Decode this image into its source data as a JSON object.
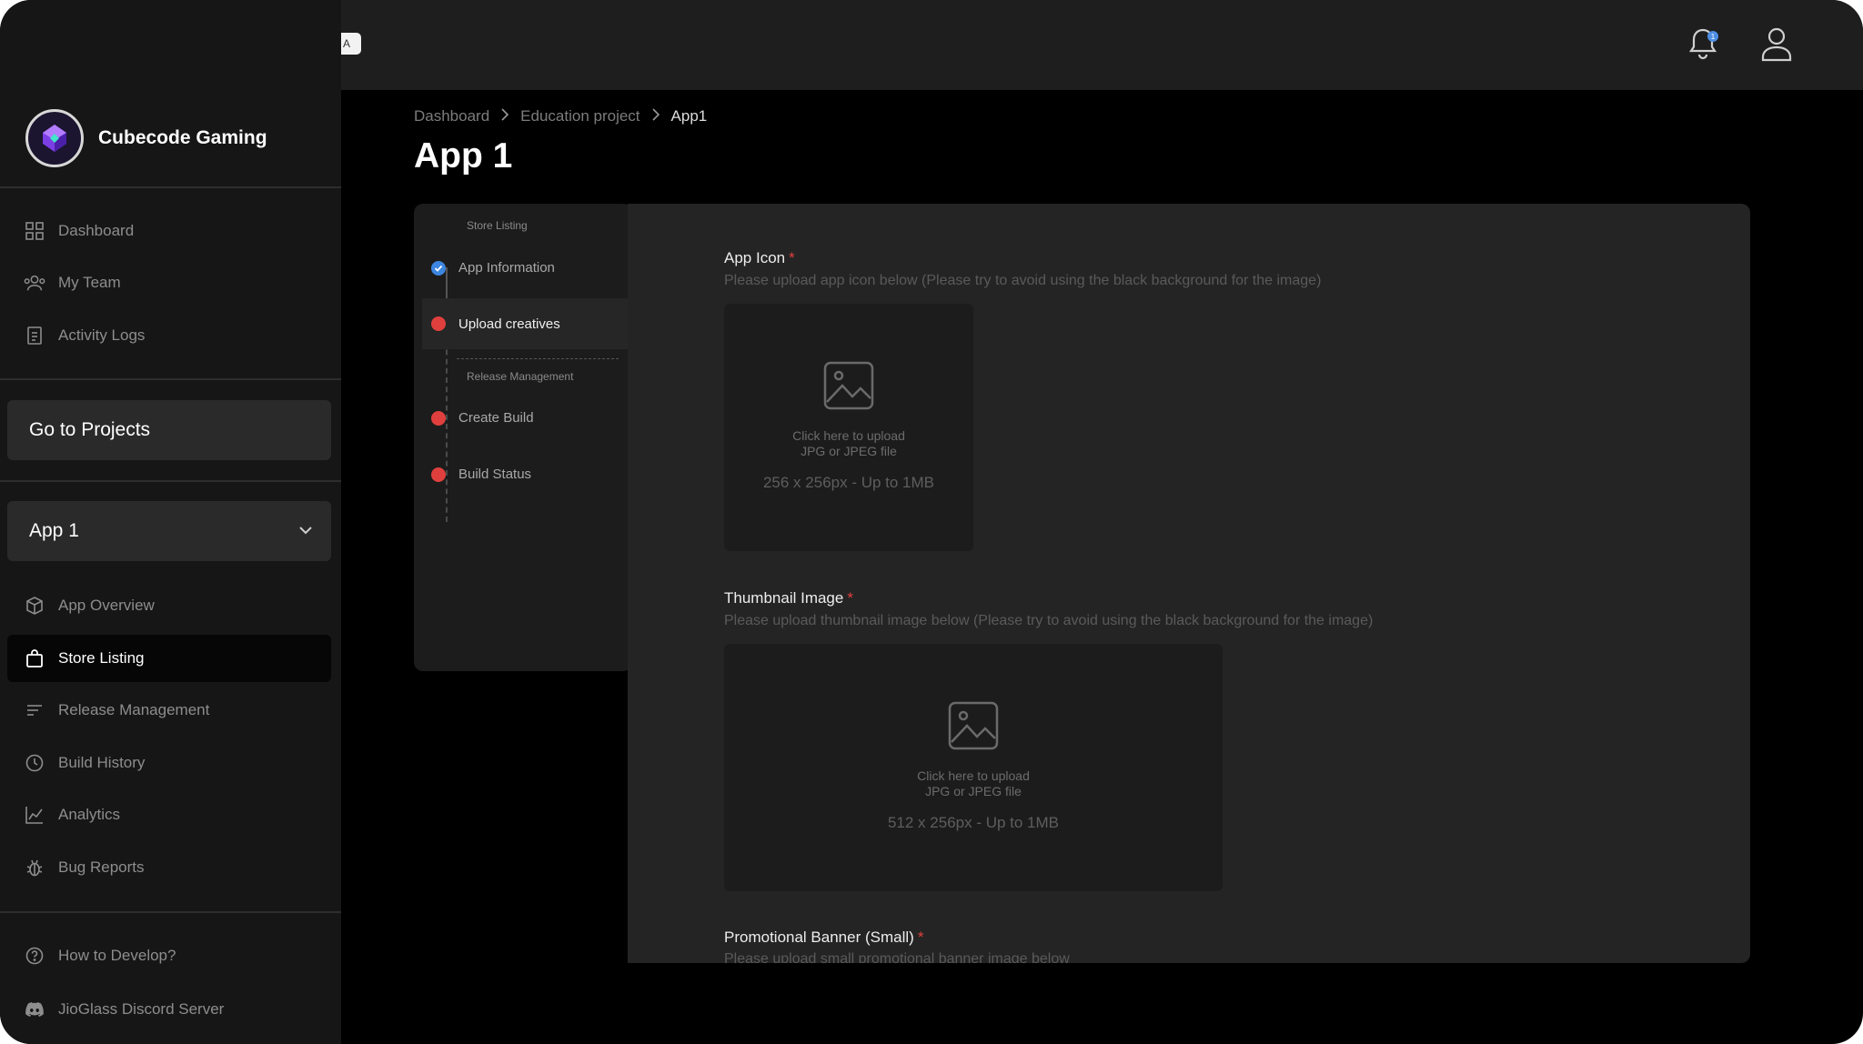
{
  "brand": {
    "name": "Cubecode Gaming"
  },
  "sidebar": {
    "top_items": [
      {
        "label": "Dashboard",
        "icon": "grid-icon"
      },
      {
        "label": "My Team",
        "icon": "team-icon"
      },
      {
        "label": "Activity Logs",
        "icon": "document-icon"
      }
    ],
    "go_to_projects": "Go to Projects",
    "app_selector": "App 1",
    "app_items": [
      {
        "label": "App Overview",
        "icon": "cube-icon"
      },
      {
        "label": "Store Listing",
        "icon": "bag-icon",
        "active": true
      },
      {
        "label": "Release Management",
        "icon": "list-icon"
      },
      {
        "label": "Build History",
        "icon": "history-icon"
      },
      {
        "label": "Analytics",
        "icon": "chart-icon"
      },
      {
        "label": "Bug Reports",
        "icon": "bug-icon"
      }
    ],
    "bottom_items": [
      {
        "label": "How to Develop?",
        "icon": "help-icon"
      },
      {
        "label": "JioGlass Discord Server",
        "icon": "discord-icon"
      }
    ]
  },
  "topbar": {
    "badge_letter": "A",
    "notification_count": "1"
  },
  "breadcrumb": [
    "Dashboard",
    "Education project",
    "App1"
  ],
  "page_title": "App 1",
  "steps": {
    "section1": "Store Listing",
    "section2": "Release Management",
    "items": [
      {
        "label": "App Information",
        "status": "done"
      },
      {
        "label": "Upload creatives",
        "status": "current"
      },
      {
        "label": "Create Build",
        "status": "pending"
      },
      {
        "label": "Build Status",
        "status": "pending"
      }
    ]
  },
  "fields": {
    "app_icon": {
      "title": "App Icon",
      "required": "*",
      "desc": "Please upload app icon below (Please try to avoid using the black background for the image)",
      "upload_line1": "Click here to upload",
      "upload_line2": "JPG or JPEG file",
      "size": "256 x 256px - Up to 1MB"
    },
    "thumbnail": {
      "title": "Thumbnail Image",
      "required": "*",
      "desc": "Please upload thumbnail image below (Please try to avoid using the black background for the image)",
      "upload_line1": "Click here to upload",
      "upload_line2": "JPG or JPEG file",
      "size": "512 x 256px - Up to 1MB"
    },
    "promo_small": {
      "title": "Promotional Banner (Small)",
      "required": "*",
      "desc": "Please upload small promotional banner image below"
    }
  },
  "colors": {
    "done": "#3d86e0",
    "error": "#e0403d",
    "notification": "#4d8fe3"
  }
}
